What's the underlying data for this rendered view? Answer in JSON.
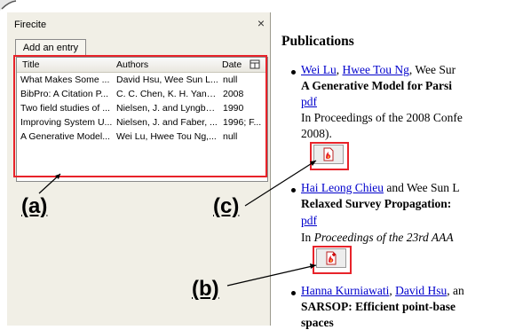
{
  "sidebar": {
    "title": "Firecite",
    "close_glyph": "×",
    "add_entry_label": "Add an entry",
    "columns": {
      "title": "Title",
      "authors": "Authors",
      "date": "Date",
      "picker_icon": "column-picker-icon"
    },
    "rows": [
      {
        "title": "What Makes Some ...",
        "authors": "David Hsu, Wee Sun L...",
        "date": "null"
      },
      {
        "title": "BibPro: A Citation P...",
        "authors": "C. C. Chen, K. H. Yang...",
        "date": "2008"
      },
      {
        "title": "Two field studies of ...",
        "authors": "Nielsen, J. and Lyngba...",
        "date": "1990"
      },
      {
        "title": "Improving System U...",
        "authors": "Nielsen, J. and Faber, ...",
        "date": "1996; F..."
      },
      {
        "title": "A Generative Model...",
        "authors": "Wei Lu, Hwee Tou Ng,...",
        "date": "null"
      }
    ]
  },
  "content": {
    "heading": "Publications",
    "pub1": {
      "author1": "Wei Lu",
      "author2": "Hwee Tou Ng",
      "authors_rest": ", Wee Sur",
      "title": "A Generative Model for Parsi",
      "pdf": "pdf",
      "venue": "In Proceedings of the 2008 Confe",
      "venue_cont": "2008)."
    },
    "pub2": {
      "author1": "Hai Leong Chieu",
      "authors_rest": " and Wee Sun L",
      "title": "Relaxed Survey Propagation:",
      "pdf": "pdf",
      "venue_prefix": "In ",
      "venue_italic": "Proceedings of the 23rd AAA"
    },
    "pub3": {
      "author1": "Hanna Kurniawati",
      "author2": "David Hsu",
      "authors_rest": ", an",
      "title": "SARSOP: Efficient point-base",
      "title_cont": "spaces"
    },
    "firecite_icon": "firecite-add-icon"
  },
  "annotations": {
    "a": "(a)",
    "b": "(b)",
    "c": "(c)"
  },
  "colors": {
    "highlight_red": "#e8232a",
    "link_blue": "#0000cc",
    "sidebar_bg": "#f1efe6"
  }
}
